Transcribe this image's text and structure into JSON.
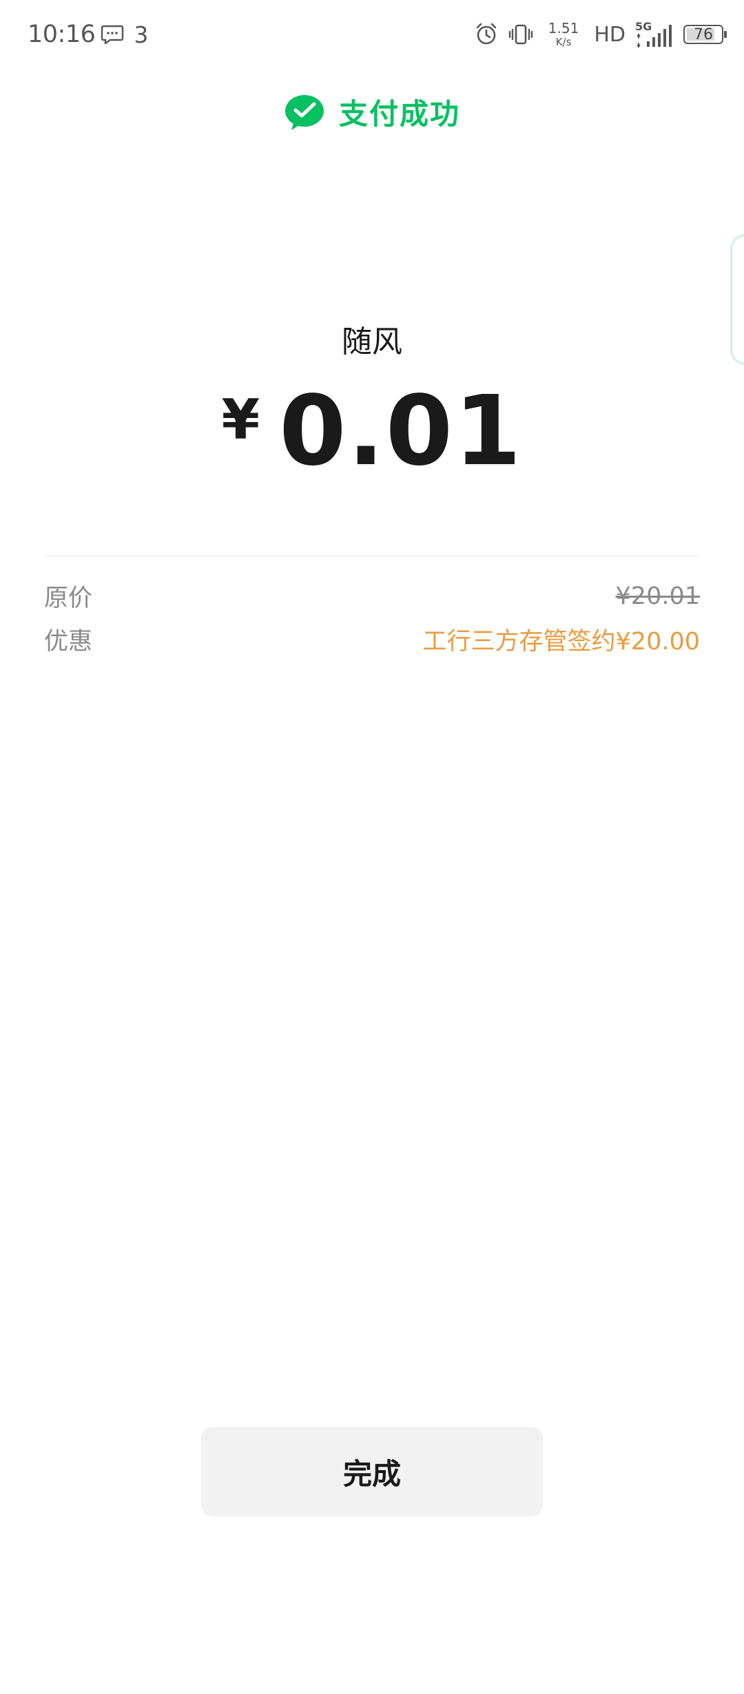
{
  "status_bar": {
    "time": "10:16",
    "notification_count": "3",
    "net_speed_value": "1.51",
    "net_speed_unit": "K/s",
    "hd_label": "HD",
    "network_label": "5G",
    "battery_level": "76",
    "icons": [
      "message-icon",
      "alarm-icon",
      "vibrate-icon",
      "signal-icon",
      "battery-icon"
    ]
  },
  "header": {
    "title": "支付成功",
    "icon": "wechat-pay-icon",
    "accent_color": "#07c160"
  },
  "payment": {
    "payee": "随风",
    "currency_symbol": "¥",
    "amount": "0.01"
  },
  "details": {
    "original_price_label": "原价",
    "original_price": "¥20.01",
    "discount_label": "优惠",
    "discount_value": "工行三方存管签约¥20.00",
    "discount_color": "#eb9b3d"
  },
  "footer": {
    "done_label": "完成"
  }
}
